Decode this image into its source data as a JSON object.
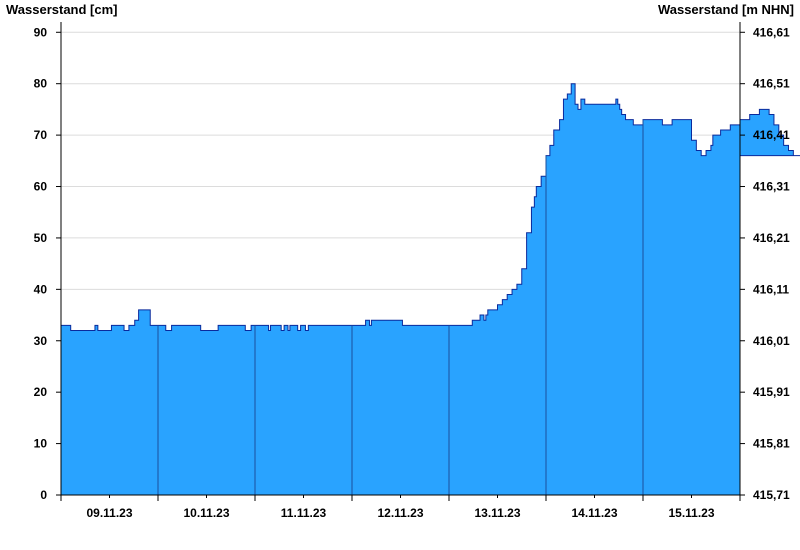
{
  "chart_data": {
    "type": "area",
    "title": "",
    "left_axis_label": "Wasserstand [cm]",
    "right_axis_label": "Wasserstand [m NHN]",
    "ylim": [
      0,
      92
    ],
    "y_ticks": [
      0,
      10,
      20,
      30,
      40,
      50,
      60,
      70,
      80,
      90
    ],
    "right_ticks": [
      "415,71",
      "415,81",
      "415,91",
      "416,01",
      "416,11",
      "416,21",
      "416,31",
      "416,41",
      "416,51",
      "416,61"
    ],
    "x_range_days": [
      8.0,
      15.0
    ],
    "day_boundaries": [
      "09.11.23",
      "10.11.23",
      "11.11.23",
      "12.11.23",
      "13.11.23",
      "14.11.23",
      "15.11.23"
    ],
    "x_tick_labels": [
      "09.11.23",
      "10.11.23",
      "11.11.23",
      "12.11.23",
      "13.11.23",
      "14.11.23",
      "15.11.23"
    ],
    "grid": true,
    "fill_color": "#29a3ff",
    "line_color": "#0a2a9c",
    "series": [
      {
        "x": [
          8.0,
          8.08,
          8.1,
          8.33,
          8.35,
          8.38,
          8.5,
          8.52,
          8.55,
          8.63,
          8.65,
          8.68,
          8.7,
          8.72,
          8.74,
          8.76,
          8.8,
          8.92,
          8.94,
          8.96,
          9.0,
          9.02,
          9.06,
          9.08,
          9.1,
          9.14,
          9.4,
          9.42,
          9.44,
          9.6,
          9.62,
          9.66,
          9.9,
          9.94,
          9.96,
          10.0,
          10.14,
          10.16,
          10.2,
          10.25,
          10.27,
          10.3,
          10.32,
          10.34,
          10.36,
          10.38,
          10.42,
          10.44,
          10.47,
          10.5,
          10.52,
          10.55,
          10.58,
          10.6,
          11.0,
          11.08,
          11.1,
          11.14,
          11.18,
          11.2,
          11.24,
          11.5,
          11.52,
          11.55,
          11.6,
          11.62,
          11.68,
          12.0,
          12.2,
          12.22,
          12.24,
          12.28,
          12.32,
          12.36,
          12.38,
          12.4,
          12.5,
          12.55,
          12.6,
          12.65,
          12.7,
          12.75,
          12.8,
          12.85,
          12.88,
          12.9,
          12.95,
          13.0,
          13.04,
          13.08,
          13.14,
          13.18,
          13.22,
          13.26,
          13.3,
          13.33,
          13.36,
          13.4,
          13.44,
          13.48,
          13.52,
          13.56,
          13.6,
          13.64,
          13.68,
          13.72,
          13.74,
          13.76,
          13.78,
          13.82,
          13.84,
          13.86,
          13.9,
          14.0,
          14.2,
          14.3,
          14.4,
          14.5,
          14.55,
          14.6,
          14.65,
          14.7,
          14.72,
          14.76,
          14.8,
          14.84,
          14.9,
          15.0,
          15.1,
          15.2,
          15.3,
          15.35,
          15.4,
          15.45,
          15.5,
          15.55,
          15.6,
          15.7
        ],
        "values": [
          33,
          33,
          32,
          32,
          33,
          32,
          32,
          33,
          33,
          33,
          32,
          32,
          33,
          33,
          33,
          34,
          36,
          33,
          33,
          33,
          33,
          33,
          33,
          32,
          32,
          33,
          33,
          33,
          32,
          32,
          33,
          33,
          32,
          32,
          33,
          33,
          32,
          33,
          33,
          33,
          32,
          33,
          33,
          32,
          33,
          33,
          33,
          32,
          33,
          33,
          32,
          33,
          33,
          33,
          33,
          33,
          33,
          34,
          33,
          34,
          34,
          34,
          33,
          33,
          33,
          33,
          33,
          33,
          33,
          33,
          34,
          34,
          35,
          34,
          35,
          36,
          37,
          38,
          39,
          40,
          41,
          44,
          51,
          56,
          58,
          60,
          62,
          66,
          68,
          71,
          73,
          77,
          78,
          80,
          76,
          75,
          77,
          76,
          76,
          76,
          76,
          76,
          76,
          76,
          76,
          77,
          76,
          75,
          74,
          73,
          73,
          73,
          72,
          73,
          72,
          73,
          73,
          69,
          67,
          66,
          67,
          68,
          70,
          70,
          71,
          71,
          72,
          73,
          74,
          75,
          74,
          72,
          70,
          68,
          67,
          66,
          66,
          66
        ]
      }
    ]
  }
}
